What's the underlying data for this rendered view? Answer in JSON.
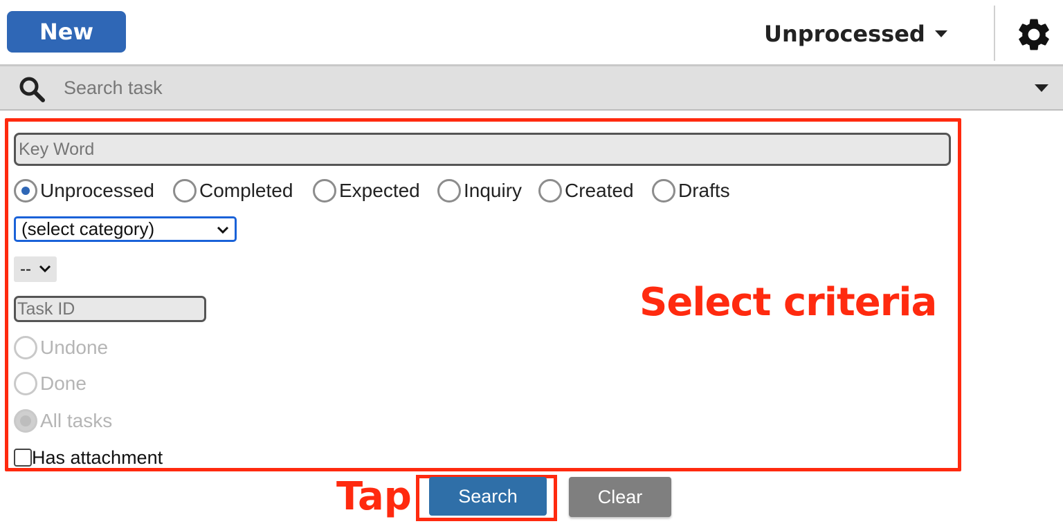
{
  "header": {
    "new_label": "New",
    "status_value": "Unprocessed",
    "settings_icon": "gear-icon"
  },
  "search": {
    "placeholder": "Search task",
    "icon": "search-icon"
  },
  "criteria": {
    "keyword_placeholder": "Key Word",
    "status_options": [
      {
        "label": "Unprocessed",
        "checked": true
      },
      {
        "label": "Completed",
        "checked": false
      },
      {
        "label": "Expected",
        "checked": false
      },
      {
        "label": "Inquiry",
        "checked": false
      },
      {
        "label": "Created",
        "checked": false
      },
      {
        "label": "Drafts",
        "checked": false
      }
    ],
    "category_value": "(select category)",
    "sub_value": "--",
    "task_id_placeholder": "Task ID",
    "done_options": [
      {
        "label": "Undone",
        "checked": false,
        "disabled": true
      },
      {
        "label": "Done",
        "checked": false,
        "disabled": true
      },
      {
        "label": "All tasks",
        "checked": true,
        "disabled": true
      }
    ],
    "attachment_label": "Has attachment",
    "attachment_checked": false
  },
  "annotations": {
    "criteria_note": "Select criteria",
    "tap_note": "Tap"
  },
  "actions": {
    "search_label": "Search",
    "clear_label": "Clear"
  },
  "colors": {
    "accent": "#2f67b6",
    "annotation": "#ff2a0f",
    "clear_button": "#7f7f7f"
  }
}
